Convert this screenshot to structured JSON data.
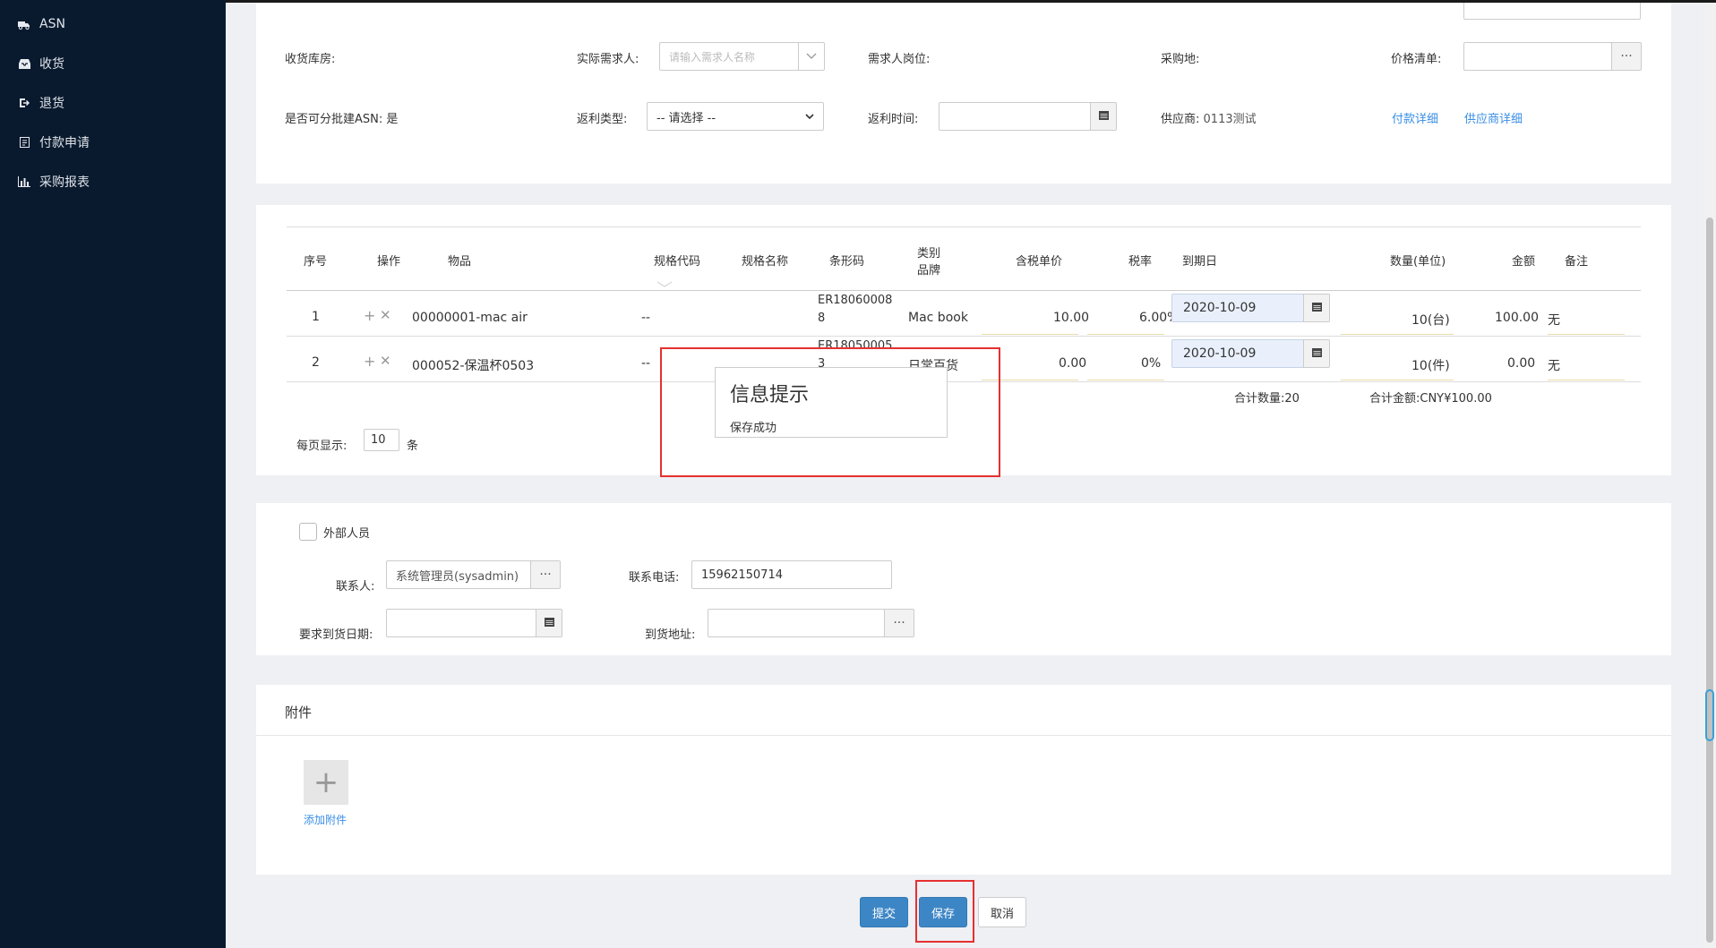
{
  "sidebar": {
    "items": [
      {
        "label": "ASN",
        "icon": "truck-icon"
      },
      {
        "label": "收货",
        "icon": "inbox-icon"
      },
      {
        "label": "退货",
        "icon": "return-icon"
      },
      {
        "label": "付款申请",
        "icon": "payment-icon"
      },
      {
        "label": "采购报表",
        "icon": "bar-chart-icon"
      }
    ]
  },
  "form": {
    "warehouse_label": "收货库房:",
    "requester_label": "实际需求人:",
    "requester_placeholder": "请输入需求人名称",
    "requester_position_label": "需求人岗位:",
    "purchase_place_label": "采购地:",
    "price_list_label": "价格清单:",
    "batch_asn_label": "是否可分批建ASN:",
    "batch_asn_value": "是",
    "rebate_type_label": "返利类型:",
    "rebate_type_value": "-- 请选择 --",
    "rebate_time_label": "返利时间:",
    "supplier_label": "供应商:",
    "supplier_value": "0113测试",
    "payment_detail_link": "付款详细",
    "supplier_detail_link": "供应商详细"
  },
  "table": {
    "headers": {
      "seq": "序号",
      "op": "操作",
      "item": "物品",
      "spec_code": "规格代码",
      "spec_name": "规格名称",
      "barcode": "条形码",
      "category": "类别",
      "brand": "品牌",
      "price": "含税单价",
      "tax": "税率",
      "due": "到期日",
      "qty": "数量(单位)",
      "amount": "金额",
      "remark": "备注"
    },
    "rows": [
      {
        "seq": "1",
        "item": "00000001-mac air",
        "spec_code": "--",
        "barcode_1": "ER18060008",
        "barcode_2": "8",
        "category": "Mac book",
        "price": "10.00",
        "tax": "6.00%",
        "due": "2020-10-09",
        "qty": "10(台)",
        "amount": "100.00",
        "remark": "无"
      },
      {
        "seq": "2",
        "item": "000052-保温杯0503",
        "spec_code": "--",
        "barcode_1": "ER18050005",
        "barcode_2": "3",
        "category": "日常百货",
        "price": "0.00",
        "tax": "0%",
        "due": "2020-10-09",
        "qty": "10(件)",
        "amount": "0.00",
        "remark": "无"
      }
    ],
    "total_qty": "合计数量:20",
    "total_amount": "合计金额:CNY¥100.00",
    "page_size_label": "每页显示:",
    "page_size_value": "10",
    "page_size_unit": "条"
  },
  "dialog": {
    "title": "信息提示",
    "message": "保存成功"
  },
  "contact": {
    "external_label": "外部人员",
    "contact_label": "联系人:",
    "contact_value": "系统管理员(sysadmin)",
    "phone_label": "联系电话:",
    "phone_value": "15962150714",
    "delivery_date_label": "要求到货日期:",
    "delivery_address_label": "到货地址:"
  },
  "attachment": {
    "title": "附件",
    "add_label": "添加附件"
  },
  "actions": {
    "submit": "提交",
    "save": "保存",
    "cancel": "取消"
  },
  "ellipsis": "···",
  "accent_color": "#3d86c6",
  "highlight_color": "#e53030"
}
